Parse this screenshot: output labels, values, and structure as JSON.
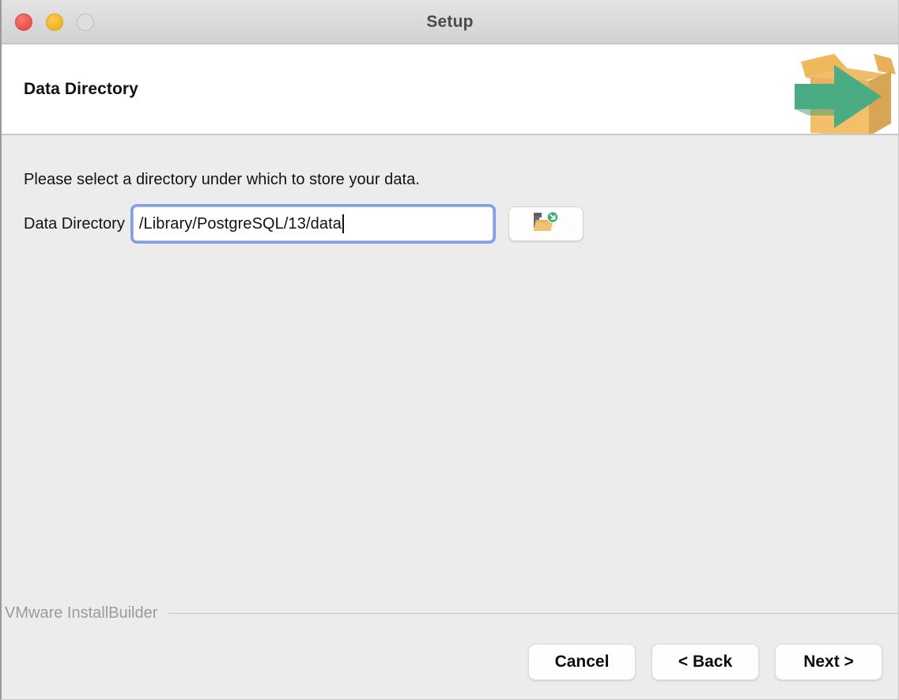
{
  "window": {
    "title": "Setup",
    "traffic_lights": [
      {
        "name": "close",
        "color": "#ed5a50",
        "state": "active"
      },
      {
        "name": "minimize",
        "color": "#f5b829",
        "state": "active"
      },
      {
        "name": "zoom",
        "color": "#dedede",
        "state": "disabled"
      }
    ]
  },
  "header": {
    "title": "Data Directory",
    "logo_icon": "installbuilder-box-arrow-icon"
  },
  "main": {
    "instruction": "Please select a directory under which to store your data.",
    "field": {
      "label": "Data Directory",
      "value": "/Library/PostgreSQL/13/data",
      "placeholder": "",
      "browse_icon": "folder-open-download-icon"
    }
  },
  "footer": {
    "brand": "VMware InstallBuilder",
    "buttons": [
      {
        "name": "cancel",
        "label": "Cancel"
      },
      {
        "name": "back",
        "label": "< Back"
      },
      {
        "name": "next",
        "label": "Next >"
      }
    ]
  },
  "colors": {
    "accent_focus": "#7e9ef0",
    "logo_box": "#efb85c",
    "logo_arrow": "#4bab82",
    "body_bg": "#ececec",
    "header_bg": "#ffffff"
  }
}
